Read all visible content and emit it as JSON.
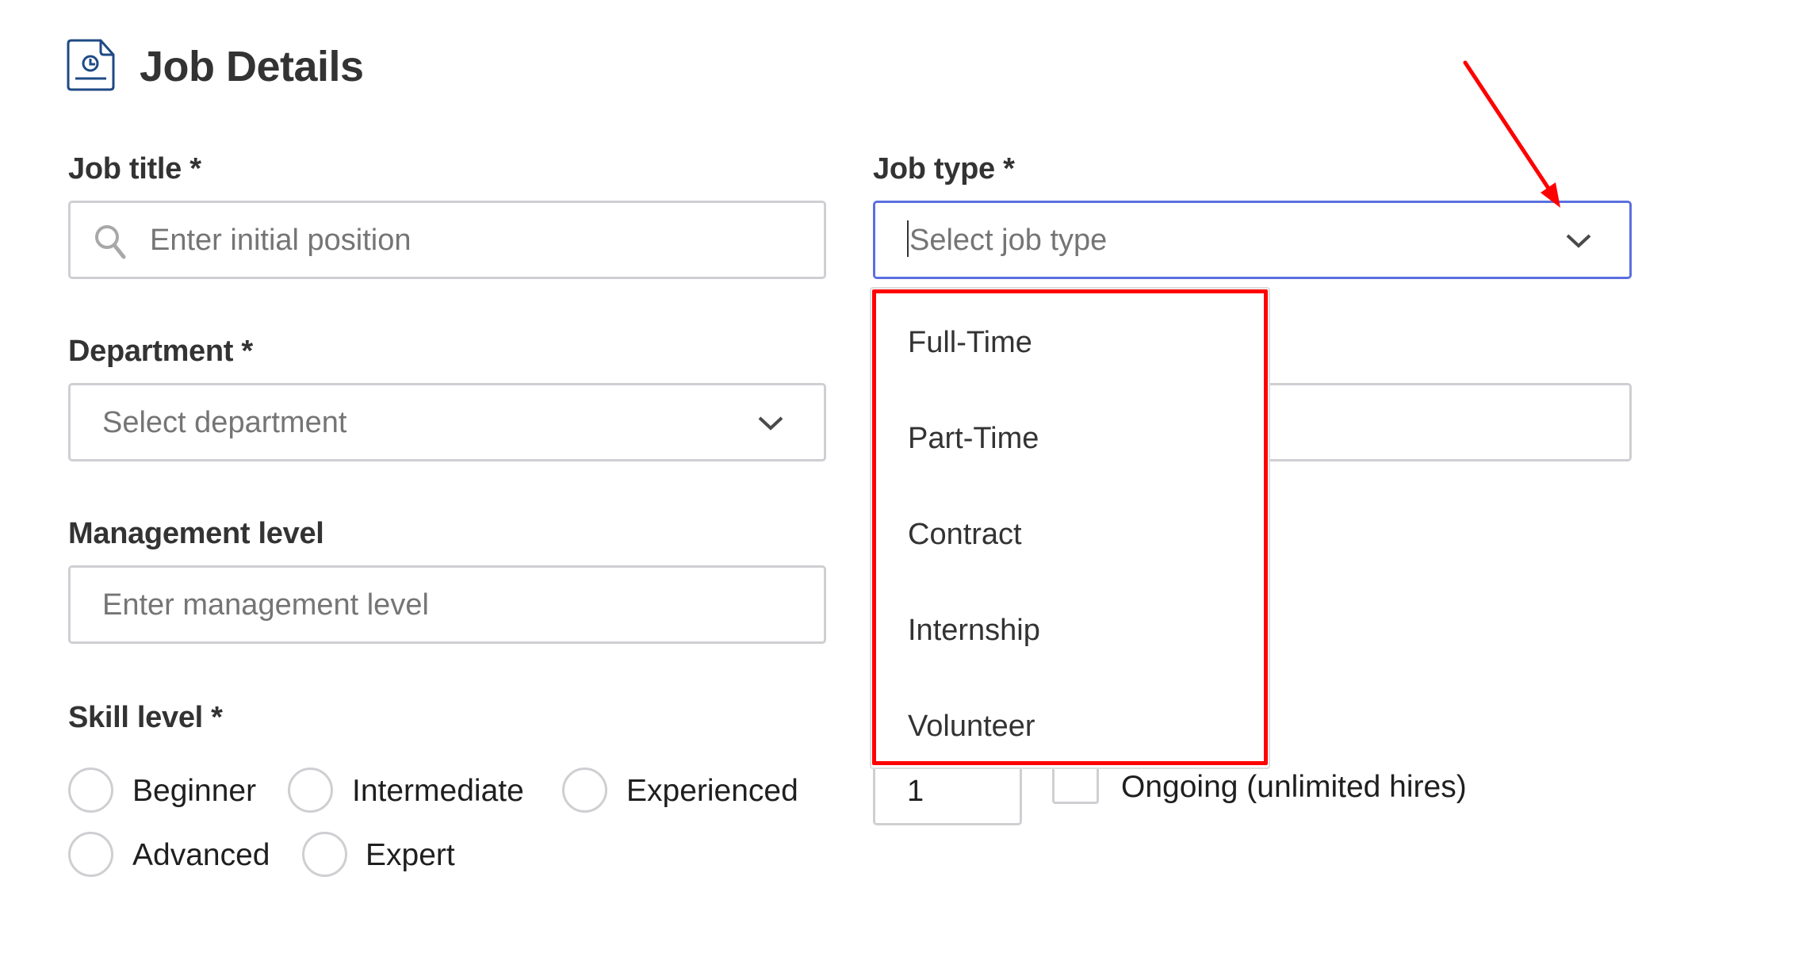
{
  "header": {
    "icon": "document-clock-icon",
    "title": "Job Details"
  },
  "form": {
    "job_title": {
      "label": "Job title *",
      "placeholder": "Enter initial position",
      "icon": "search-icon"
    },
    "job_type": {
      "label": "Job type *",
      "placeholder": "Select job type",
      "icon": "chevron-down-icon",
      "state": "open",
      "options": [
        "Full-Time",
        "Part-Time",
        "Contract",
        "Internship",
        "Volunteer"
      ]
    },
    "department": {
      "label": "Department *",
      "placeholder": "Select department",
      "icon": "chevron-down-icon"
    },
    "management_level": {
      "label": "Management level",
      "placeholder": "Enter management level"
    },
    "skill_level": {
      "label": "Skill level *",
      "options": [
        "Beginner",
        "Intermediate",
        "Experienced",
        "Advanced",
        "Expert"
      ]
    },
    "openings": {
      "value": "1",
      "ongoing_label": "Ongoing (unlimited hires)",
      "ongoing_checked": false
    }
  },
  "annotation": {
    "color": "#ff0000",
    "arrow_target": "job-type-chevron",
    "highlight_target": "job-type-options-menu"
  },
  "colors": {
    "text": "#333333",
    "placeholder": "#757575",
    "border": "#cfcfd3",
    "focus_border": "#5b6fe0",
    "icon_blue": "#1f4a85"
  }
}
